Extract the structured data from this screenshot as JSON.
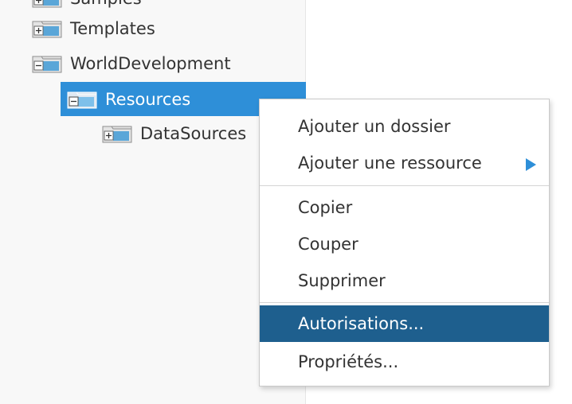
{
  "tree": {
    "nodes": [
      {
        "label": "Samples",
        "state": "collapsed",
        "selected": false
      },
      {
        "label": "Templates",
        "state": "collapsed",
        "selected": false
      },
      {
        "label": "WorldDevelopment",
        "state": "expanded",
        "selected": false
      },
      {
        "label": "Resources",
        "state": "expanded",
        "selected": true
      },
      {
        "label": "DataSources",
        "state": "collapsed",
        "selected": false
      }
    ],
    "icon": "folder-icon",
    "colors": {
      "selected_background": "#2e8fd8",
      "selected_text": "#ffffff",
      "panel_background": "#f8f8f8"
    }
  },
  "context_menu": {
    "groups": [
      {
        "items": [
          {
            "label": "Ajouter un dossier",
            "has_submenu": false
          },
          {
            "label": "Ajouter une ressource",
            "has_submenu": true
          }
        ]
      },
      {
        "items": [
          {
            "label": "Copier",
            "has_submenu": false
          },
          {
            "label": "Couper",
            "has_submenu": false
          },
          {
            "label": "Supprimer",
            "has_submenu": false
          }
        ]
      },
      {
        "items": [
          {
            "label": "Autorisations...",
            "has_submenu": false,
            "highlighted": true
          },
          {
            "label": "Propriétés...",
            "has_submenu": false
          }
        ]
      }
    ],
    "colors": {
      "highlight_background": "#1e5f8e",
      "highlight_text": "#ffffff",
      "submenu_arrow": "#2e8fd8"
    }
  }
}
